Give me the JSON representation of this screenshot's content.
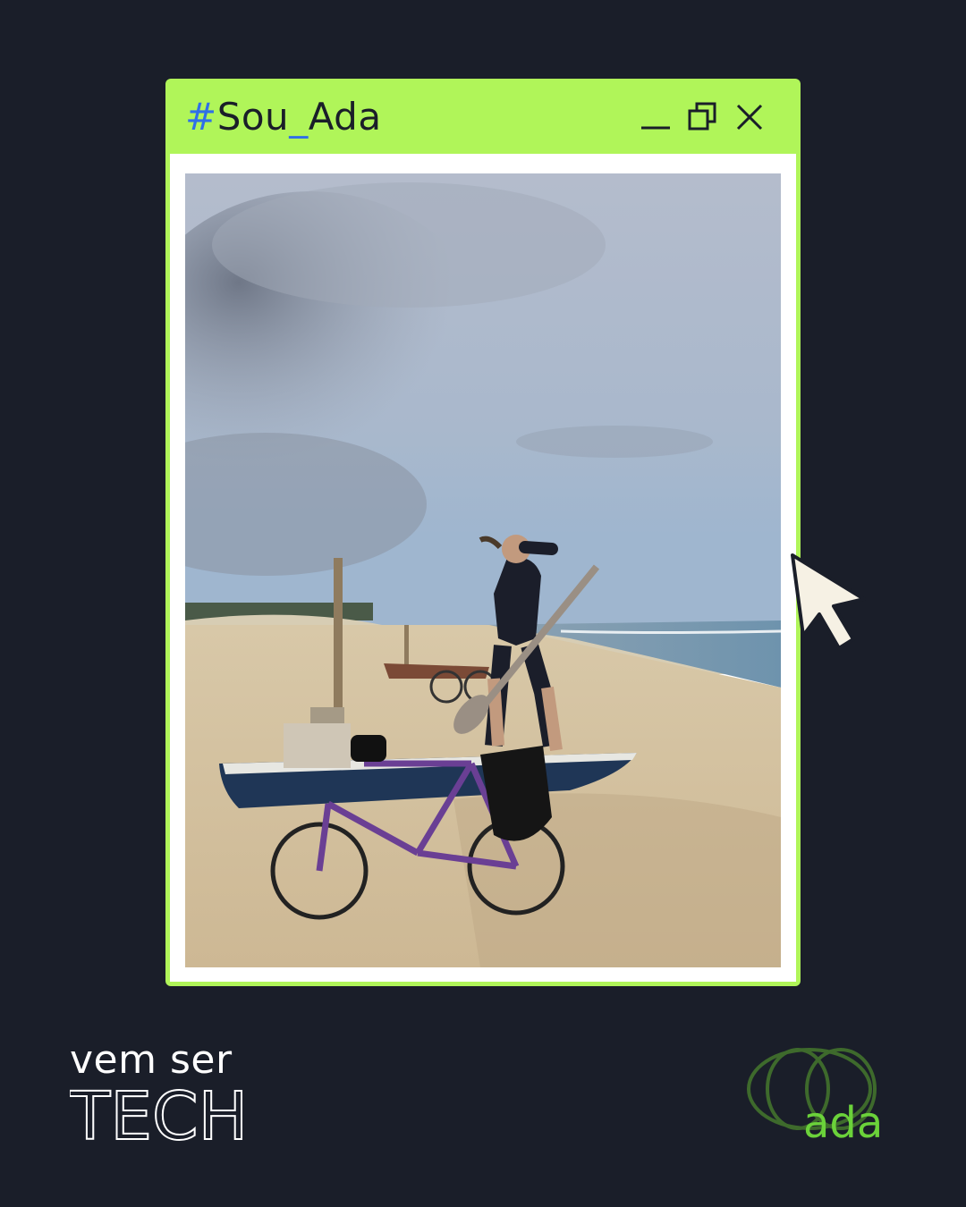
{
  "window": {
    "title_hash": "#",
    "title_part1": "Sou",
    "title_underscore": "_",
    "title_part2": "Ada",
    "controls": [
      "minimize-icon",
      "restore-icon",
      "close-icon"
    ]
  },
  "photo": {
    "scene": "person-with-paddle-on-beach-boat-with-bicycle"
  },
  "footer": {
    "tagline_line1": "vem ser",
    "tagline_line2": "TECH",
    "brand": "ada"
  },
  "colors": {
    "background": "#1a1e29",
    "accent_green": "#b0f559",
    "accent_blue": "#2f6fe8",
    "logo_green": "#6bd23a",
    "logo_dark_green": "#3e6a2c"
  }
}
